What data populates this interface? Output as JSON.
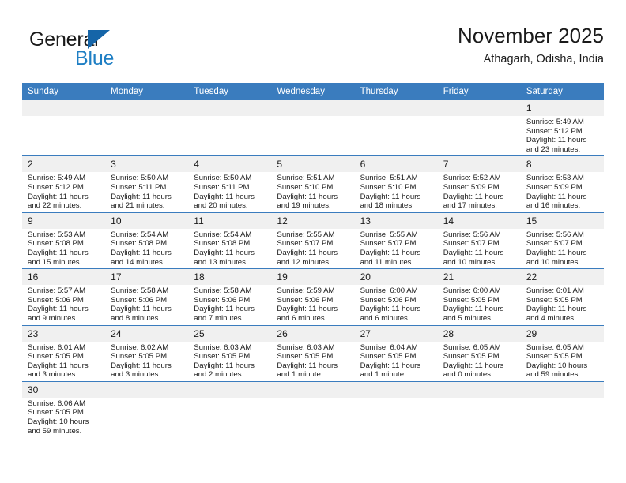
{
  "brand": {
    "name_primary": "General",
    "name_secondary": "Blue",
    "accent_color": "#1f7fc4",
    "triangle_color": "#1565a8"
  },
  "header": {
    "title": "November 2025",
    "subtitle": "Athagarh, Odisha, India"
  },
  "theme": {
    "header_row_bg": "#3a7cbe",
    "daynum_bg": "#f0f0f0",
    "grid_line": "#3a7cbe",
    "text": "#1a1a1a"
  },
  "weekday_headers": [
    "Sunday",
    "Monday",
    "Tuesday",
    "Wednesday",
    "Thursday",
    "Friday",
    "Saturday"
  ],
  "weeks": [
    [
      {
        "day": "",
        "empty": true
      },
      {
        "day": "",
        "empty": true
      },
      {
        "day": "",
        "empty": true
      },
      {
        "day": "",
        "empty": true
      },
      {
        "day": "",
        "empty": true
      },
      {
        "day": "",
        "empty": true
      },
      {
        "day": "1",
        "sunrise": "Sunrise: 5:49 AM",
        "sunset": "Sunset: 5:12 PM",
        "daylight": "Daylight: 11 hours and 23 minutes."
      }
    ],
    [
      {
        "day": "2",
        "sunrise": "Sunrise: 5:49 AM",
        "sunset": "Sunset: 5:12 PM",
        "daylight": "Daylight: 11 hours and 22 minutes."
      },
      {
        "day": "3",
        "sunrise": "Sunrise: 5:50 AM",
        "sunset": "Sunset: 5:11 PM",
        "daylight": "Daylight: 11 hours and 21 minutes."
      },
      {
        "day": "4",
        "sunrise": "Sunrise: 5:50 AM",
        "sunset": "Sunset: 5:11 PM",
        "daylight": "Daylight: 11 hours and 20 minutes."
      },
      {
        "day": "5",
        "sunrise": "Sunrise: 5:51 AM",
        "sunset": "Sunset: 5:10 PM",
        "daylight": "Daylight: 11 hours and 19 minutes."
      },
      {
        "day": "6",
        "sunrise": "Sunrise: 5:51 AM",
        "sunset": "Sunset: 5:10 PM",
        "daylight": "Daylight: 11 hours and 18 minutes."
      },
      {
        "day": "7",
        "sunrise": "Sunrise: 5:52 AM",
        "sunset": "Sunset: 5:09 PM",
        "daylight": "Daylight: 11 hours and 17 minutes."
      },
      {
        "day": "8",
        "sunrise": "Sunrise: 5:53 AM",
        "sunset": "Sunset: 5:09 PM",
        "daylight": "Daylight: 11 hours and 16 minutes."
      }
    ],
    [
      {
        "day": "9",
        "sunrise": "Sunrise: 5:53 AM",
        "sunset": "Sunset: 5:08 PM",
        "daylight": "Daylight: 11 hours and 15 minutes."
      },
      {
        "day": "10",
        "sunrise": "Sunrise: 5:54 AM",
        "sunset": "Sunset: 5:08 PM",
        "daylight": "Daylight: 11 hours and 14 minutes."
      },
      {
        "day": "11",
        "sunrise": "Sunrise: 5:54 AM",
        "sunset": "Sunset: 5:08 PM",
        "daylight": "Daylight: 11 hours and 13 minutes."
      },
      {
        "day": "12",
        "sunrise": "Sunrise: 5:55 AM",
        "sunset": "Sunset: 5:07 PM",
        "daylight": "Daylight: 11 hours and 12 minutes."
      },
      {
        "day": "13",
        "sunrise": "Sunrise: 5:55 AM",
        "sunset": "Sunset: 5:07 PM",
        "daylight": "Daylight: 11 hours and 11 minutes."
      },
      {
        "day": "14",
        "sunrise": "Sunrise: 5:56 AM",
        "sunset": "Sunset: 5:07 PM",
        "daylight": "Daylight: 11 hours and 10 minutes."
      },
      {
        "day": "15",
        "sunrise": "Sunrise: 5:56 AM",
        "sunset": "Sunset: 5:07 PM",
        "daylight": "Daylight: 11 hours and 10 minutes."
      }
    ],
    [
      {
        "day": "16",
        "sunrise": "Sunrise: 5:57 AM",
        "sunset": "Sunset: 5:06 PM",
        "daylight": "Daylight: 11 hours and 9 minutes."
      },
      {
        "day": "17",
        "sunrise": "Sunrise: 5:58 AM",
        "sunset": "Sunset: 5:06 PM",
        "daylight": "Daylight: 11 hours and 8 minutes."
      },
      {
        "day": "18",
        "sunrise": "Sunrise: 5:58 AM",
        "sunset": "Sunset: 5:06 PM",
        "daylight": "Daylight: 11 hours and 7 minutes."
      },
      {
        "day": "19",
        "sunrise": "Sunrise: 5:59 AM",
        "sunset": "Sunset: 5:06 PM",
        "daylight": "Daylight: 11 hours and 6 minutes."
      },
      {
        "day": "20",
        "sunrise": "Sunrise: 6:00 AM",
        "sunset": "Sunset: 5:06 PM",
        "daylight": "Daylight: 11 hours and 6 minutes."
      },
      {
        "day": "21",
        "sunrise": "Sunrise: 6:00 AM",
        "sunset": "Sunset: 5:05 PM",
        "daylight": "Daylight: 11 hours and 5 minutes."
      },
      {
        "day": "22",
        "sunrise": "Sunrise: 6:01 AM",
        "sunset": "Sunset: 5:05 PM",
        "daylight": "Daylight: 11 hours and 4 minutes."
      }
    ],
    [
      {
        "day": "23",
        "sunrise": "Sunrise: 6:01 AM",
        "sunset": "Sunset: 5:05 PM",
        "daylight": "Daylight: 11 hours and 3 minutes."
      },
      {
        "day": "24",
        "sunrise": "Sunrise: 6:02 AM",
        "sunset": "Sunset: 5:05 PM",
        "daylight": "Daylight: 11 hours and 3 minutes."
      },
      {
        "day": "25",
        "sunrise": "Sunrise: 6:03 AM",
        "sunset": "Sunset: 5:05 PM",
        "daylight": "Daylight: 11 hours and 2 minutes."
      },
      {
        "day": "26",
        "sunrise": "Sunrise: 6:03 AM",
        "sunset": "Sunset: 5:05 PM",
        "daylight": "Daylight: 11 hours and 1 minute."
      },
      {
        "day": "27",
        "sunrise": "Sunrise: 6:04 AM",
        "sunset": "Sunset: 5:05 PM",
        "daylight": "Daylight: 11 hours and 1 minute."
      },
      {
        "day": "28",
        "sunrise": "Sunrise: 6:05 AM",
        "sunset": "Sunset: 5:05 PM",
        "daylight": "Daylight: 11 hours and 0 minutes."
      },
      {
        "day": "29",
        "sunrise": "Sunrise: 6:05 AM",
        "sunset": "Sunset: 5:05 PM",
        "daylight": "Daylight: 10 hours and 59 minutes."
      }
    ],
    [
      {
        "day": "30",
        "sunrise": "Sunrise: 6:06 AM",
        "sunset": "Sunset: 5:05 PM",
        "daylight": "Daylight: 10 hours and 59 minutes."
      },
      {
        "day": "",
        "empty": true
      },
      {
        "day": "",
        "empty": true
      },
      {
        "day": "",
        "empty": true
      },
      {
        "day": "",
        "empty": true
      },
      {
        "day": "",
        "empty": true
      },
      {
        "day": "",
        "empty": true
      }
    ]
  ]
}
